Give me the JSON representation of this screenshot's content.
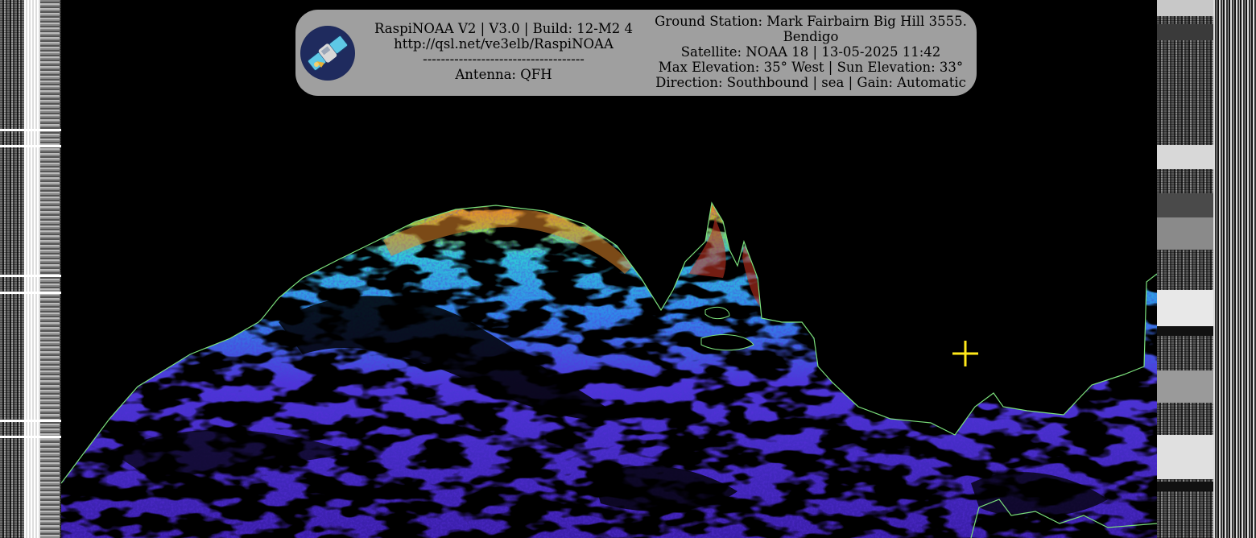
{
  "banner": {
    "title": "RaspiNOAA V2 | V3.0 | Build: 12-M2 4",
    "url": "http://qsl.net/ve3elb/RaspiNOAA",
    "separator": "------------------------------------",
    "antenna": "Antenna: QFH",
    "ground_station_line1": "Ground Station: Mark Fairbairn Big Hill 3555.",
    "ground_station_line2": "Bendigo",
    "satellite": "Satellite: NOAA 18 | 13-05-2025 11:42",
    "elevation": "Max Elevation: 35° West | Sun Elevation: 33°",
    "direction": "Direction: Southbound | sea | Gain: Automatic",
    "background_color": "#9f9f9f",
    "logo_icon": "satellite-logo-icon"
  },
  "imagery": {
    "kind": "NOAA APT sea-surface false-color enhancement",
    "background_color": "#000000",
    "coastline_color": "#7be07b",
    "palette": [
      "#3b1fb8",
      "#5a2ee0",
      "#2f6fe8",
      "#2fb6e0",
      "#4fd6b0",
      "#d8d23a",
      "#e0862a",
      "#c0301e"
    ],
    "marker_icon": "crosshair-icon",
    "marker_color": "#ffe81a"
  }
}
